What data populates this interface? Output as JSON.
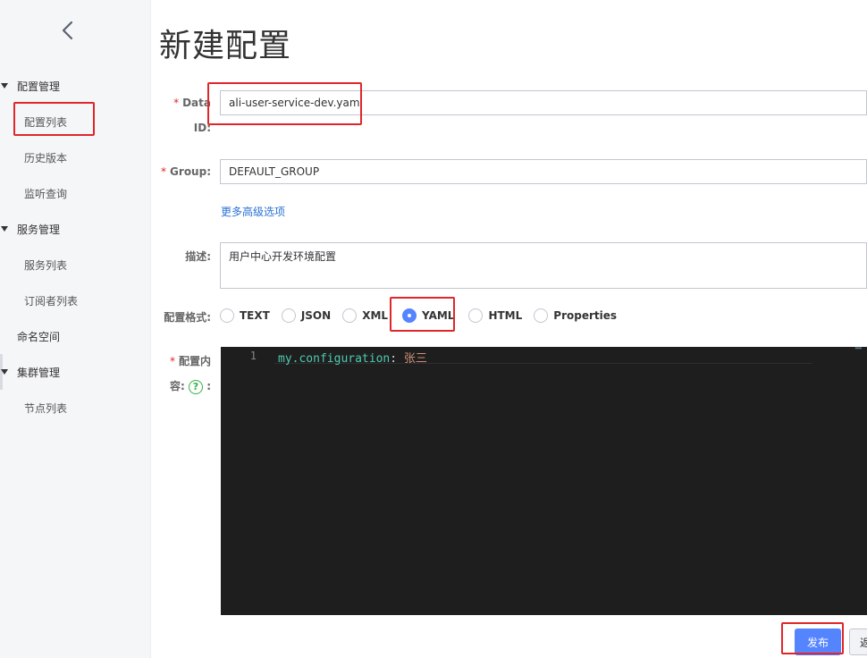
{
  "sidebar": {
    "groups": [
      {
        "label": "配置管理",
        "items": [
          "配置列表",
          "历史版本",
          "监听查询"
        ]
      },
      {
        "label": "服务管理",
        "items": [
          "服务列表",
          "订阅者列表"
        ]
      },
      {
        "label": "命名空间"
      },
      {
        "label": "集群管理",
        "items": [
          "节点列表"
        ]
      }
    ]
  },
  "page": {
    "title": "新建配置"
  },
  "form": {
    "data_id": {
      "label_line1": "Data",
      "label_line2": "ID:",
      "value": "ali-user-service-dev.yaml"
    },
    "group": {
      "label": "Group:",
      "value": "DEFAULT_GROUP"
    },
    "advanced_link": "更多高级选项",
    "description": {
      "label": "描述:",
      "value": "用户中心开发环境配置"
    },
    "format": {
      "label": "配置格式:",
      "options": [
        "TEXT",
        "JSON",
        "XML",
        "YAML",
        "HTML",
        "Properties"
      ],
      "selected": "YAML"
    },
    "content": {
      "label_line1": "配置内",
      "label_line2_prefix": "容:",
      "label_line2_suffix": ":",
      "help_glyph": "?",
      "line_number": "1",
      "key": "my.configuration",
      "colon": ":",
      "value": "张三"
    }
  },
  "buttons": {
    "publish": "发布",
    "back": "返"
  },
  "icons": {
    "collapse": "chevron-left-icon",
    "help": "question-circle-icon"
  },
  "colors": {
    "accent": "#5584ff",
    "required": "#e0262a",
    "link": "#2a72d6",
    "highlight_box": "#e0262a"
  }
}
